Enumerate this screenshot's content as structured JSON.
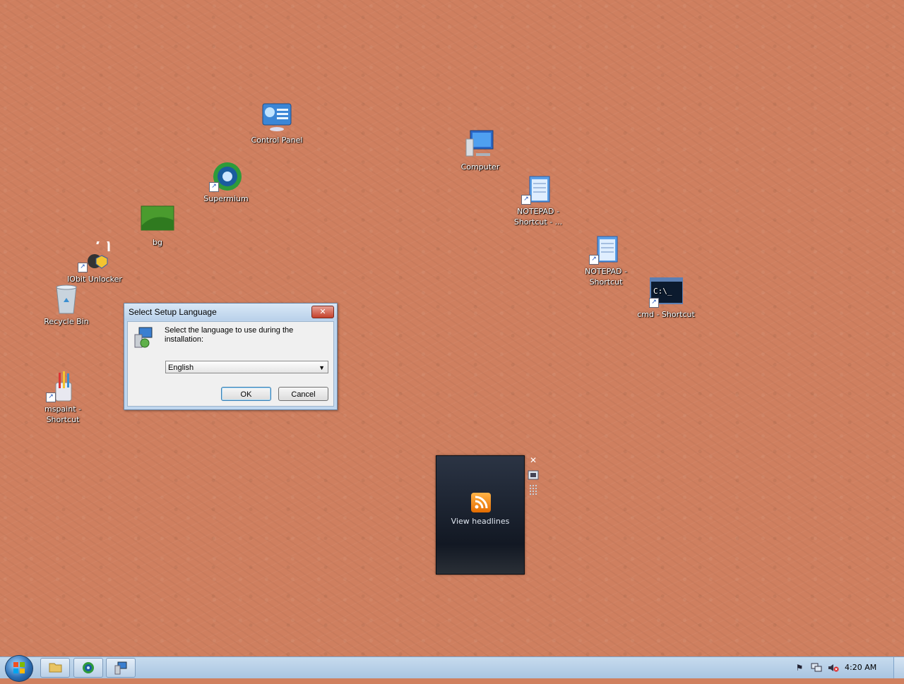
{
  "desktop": {
    "icons": [
      {
        "label": "Control Panel"
      },
      {
        "label": "Supermium"
      },
      {
        "label": "bg"
      },
      {
        "label": "IObit Unlocker"
      },
      {
        "label": "Recycle Bin"
      },
      {
        "label": "mspaint - Shortcut"
      },
      {
        "label": "Computer"
      },
      {
        "label": "NOTEPAD - Shortcut - ..."
      },
      {
        "label": "NOTEPAD - Shortcut"
      },
      {
        "label": "cmd - Shortcut"
      }
    ]
  },
  "dialog": {
    "title": "Select Setup Language",
    "close_label": "✕",
    "message": "Select the language to use during the installation:",
    "language_selected": "English",
    "ok_label": "OK",
    "cancel_label": "Cancel"
  },
  "gadget": {
    "label": "View headlines",
    "close_label": "✕"
  },
  "taskbar": {
    "clock": "4:20 AM"
  },
  "colors": {
    "desktop_background": "#cf7f5f",
    "gadget_background": "#121823",
    "taskbar": "#b9d0e7"
  }
}
